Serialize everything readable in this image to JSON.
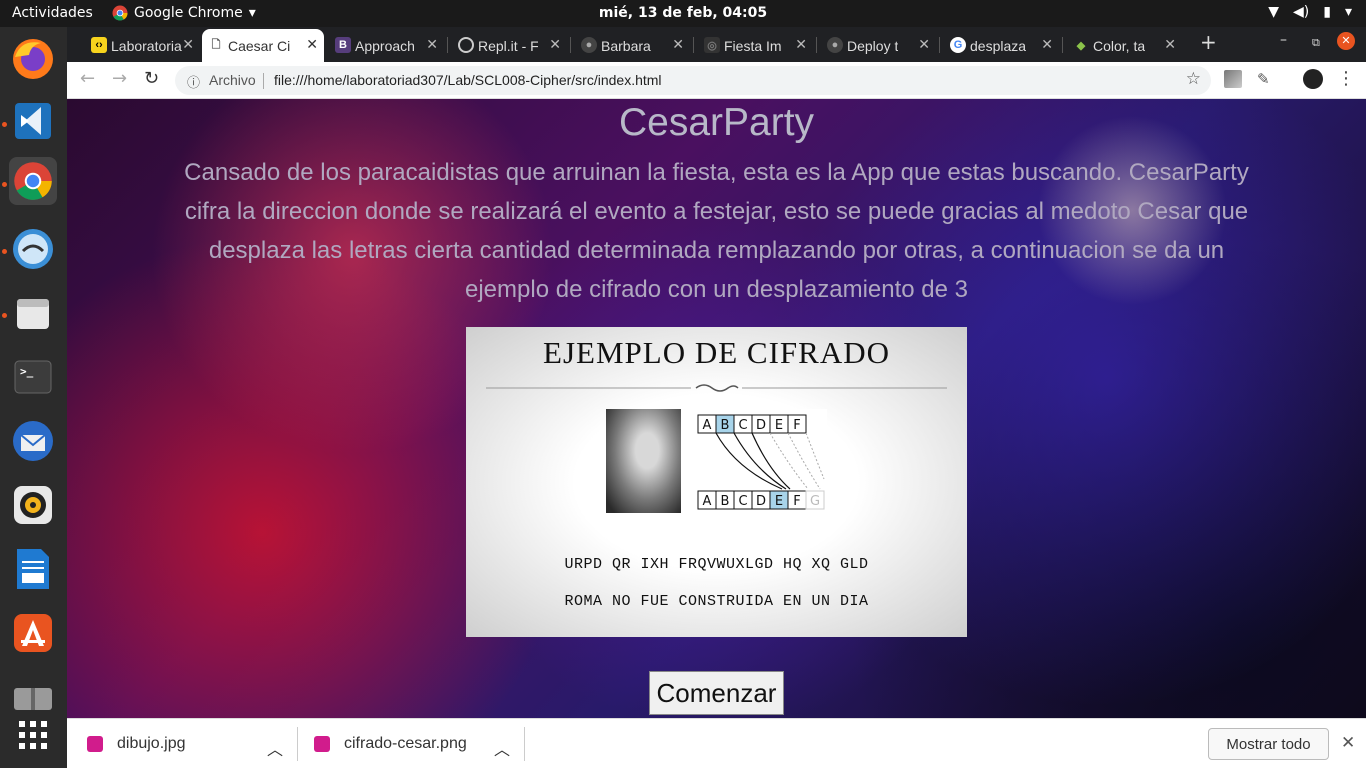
{
  "topbar": {
    "activities": "Actividades",
    "app_name": "Google Chrome",
    "clock": "mié, 13 de feb, 04:05"
  },
  "dock": {
    "apps": [
      "firefox-icon",
      "vscode-icon",
      "chrome-icon",
      "cool-retro-term-icon",
      "files-icon",
      "terminal-icon",
      "thunderbird-icon",
      "rhythmbox-icon",
      "libreoffice-writer-icon",
      "software-center-icon",
      "archive-icon",
      "apps-grid-icon"
    ]
  },
  "tabs": [
    {
      "label": "Laboratoria",
      "icon": "laboratoria-icon",
      "color": "#f7d31d"
    },
    {
      "label": "Caesar Cipher",
      "icon": "file-icon",
      "color": "#ffffff"
    },
    {
      "label": "Approach",
      "icon": "bootstrap-icon",
      "color": "#563d7c"
    },
    {
      "label": "Repl.it - F",
      "icon": "replit-icon",
      "color": "#aaaaaa"
    },
    {
      "label": "Barbara",
      "icon": "github-icon",
      "color": "#aaaaaa"
    },
    {
      "label": "Fiesta Im",
      "icon": "fiesta-icon",
      "color": "#555555"
    },
    {
      "label": "Deploy t",
      "icon": "github-icon",
      "color": "#aaaaaa"
    },
    {
      "label": "desplaza",
      "icon": "google-icon",
      "color": "#4285f4"
    },
    {
      "label": "Color, ta",
      "icon": "color-icon",
      "color": "#8bc34a"
    }
  ],
  "toolbar": {
    "info_label": "Archivo",
    "url": "file:///home/laboratoriad307/Lab/SCL008-Cipher/src/index.html"
  },
  "page": {
    "title": "CesarParty",
    "description": "Cansado de los paracaidistas que arruinan la fiesta, esta es la App que estas buscando. CesarParty cifra la direccion donde se realizará el evento a festejar, esto se puede gracias al medoto Cesar que desplaza las letras cierta cantidad determinada remplazando por otras, a continuacion se da un ejemplo de cifrado con un desplazamiento de 3",
    "card_title": "EJEMPLO DE CIFRADO",
    "shift_top": [
      "A",
      "B",
      "C",
      "D",
      "E",
      "F"
    ],
    "shift_bottom": [
      "A",
      "B",
      "C",
      "D",
      "E",
      "F",
      "G"
    ],
    "cipher_text": "URPD QR IXH FRQVWUXLGD HQ XQ GLD",
    "plain_text": "ROMA NO FUE CONSTRUIDA EN UN DIA",
    "start_button": "Comenzar"
  },
  "downloads": {
    "items": [
      "dibujo.jpg",
      "cifrado-cesar.png"
    ],
    "show_all": "Mostrar todo"
  }
}
